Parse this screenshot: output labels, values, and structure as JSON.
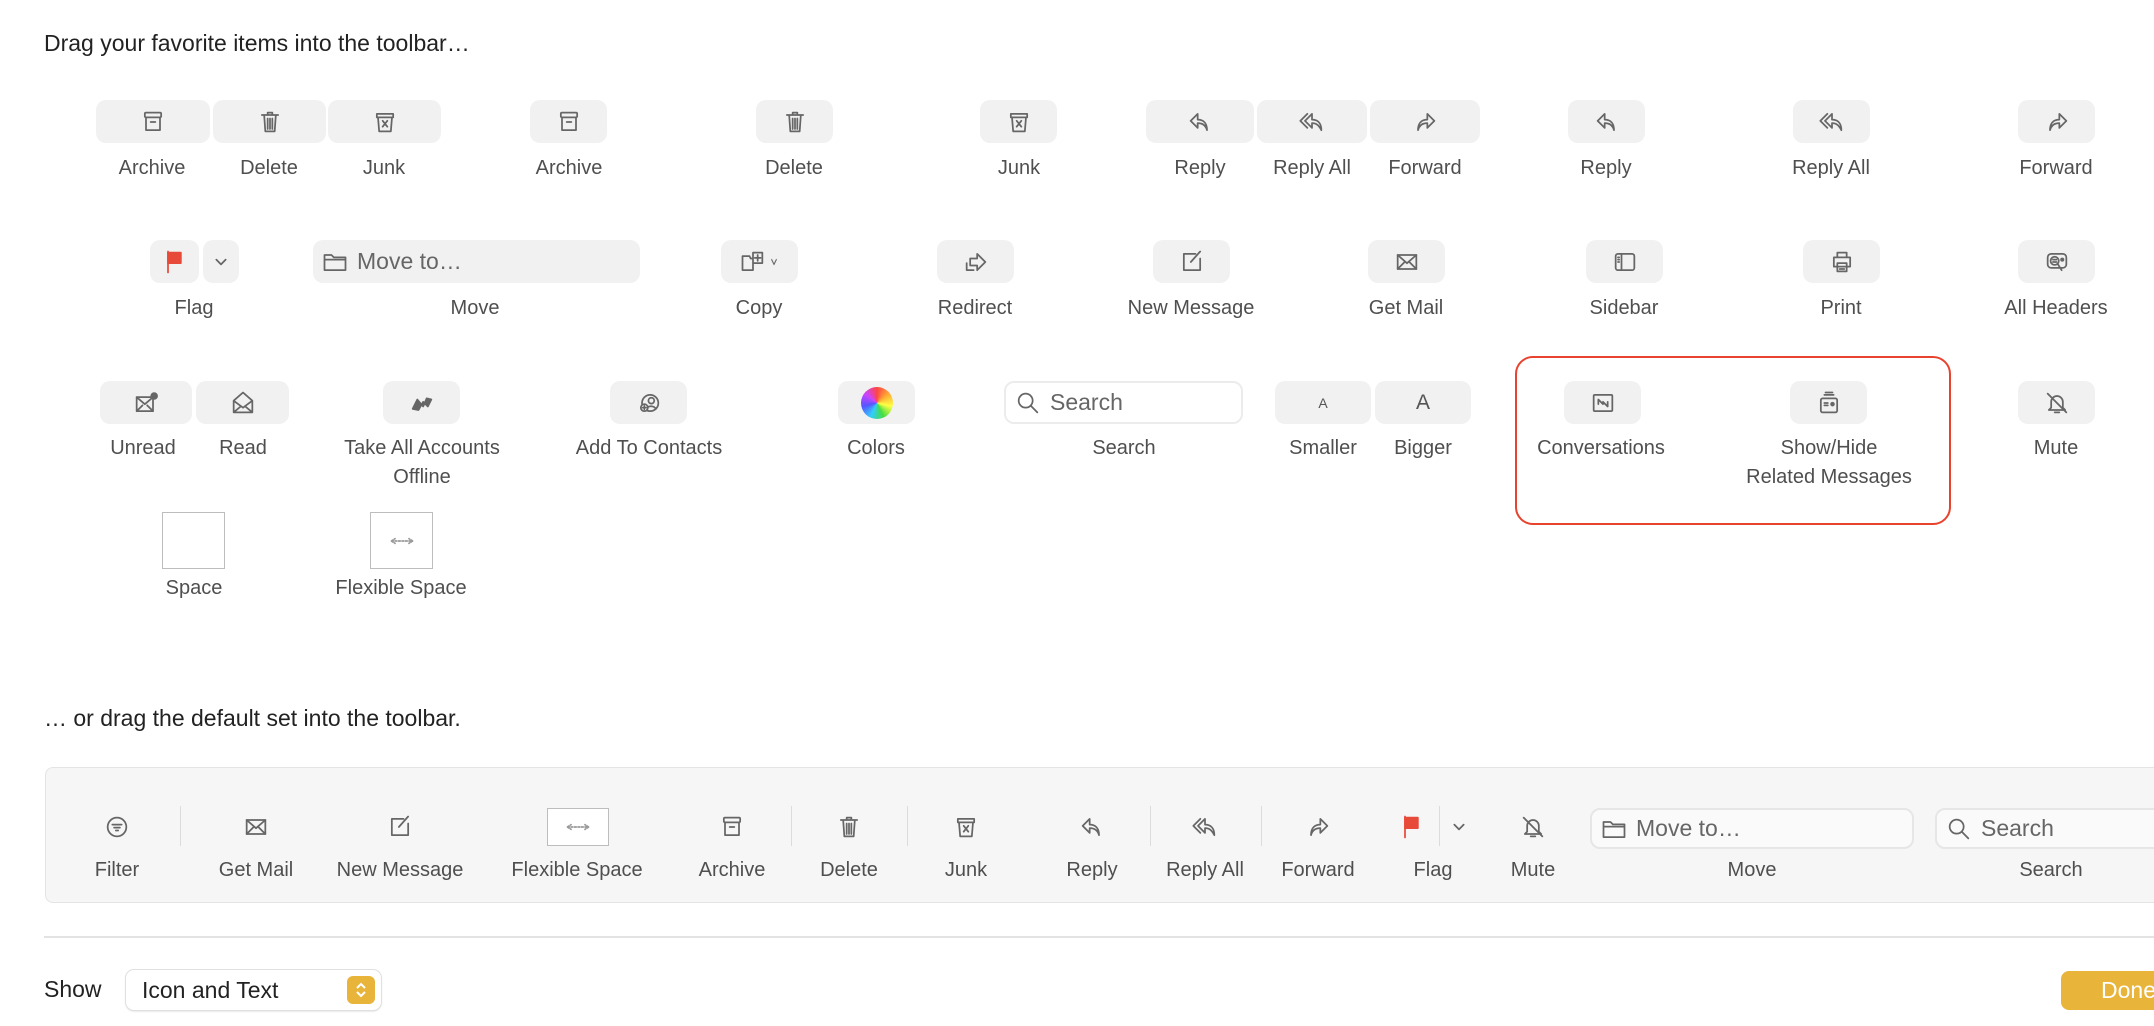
{
  "header": {
    "favorites_text": "Drag your favorite items into the toolbar…",
    "default_text": "… or drag the default set into the toolbar."
  },
  "palette": {
    "row1": [
      "Archive",
      "Delete",
      "Junk",
      "Archive",
      "Delete",
      "Junk",
      "Reply",
      "Reply All",
      "Forward",
      "Reply",
      "Reply All",
      "Forward"
    ],
    "row2": {
      "flag": "Flag",
      "move_field": "Move to…",
      "move": "Move",
      "copy": "Copy",
      "redirect": "Redirect",
      "new_message": "New Message",
      "get_mail": "Get Mail",
      "sidebar": "Sidebar",
      "print": "Print",
      "all_headers": "All Headers"
    },
    "row3": {
      "unread": "Unread",
      "read": "Read",
      "take_offline_1": "Take All Accounts",
      "take_offline_2": "Offline",
      "add_contacts": "Add To Contacts",
      "colors": "Colors",
      "search_placeholder": "Search",
      "search": "Search",
      "smaller": "Smaller",
      "bigger": "Bigger",
      "smaller_glyph": "A",
      "bigger_glyph": "A",
      "conversations": "Conversations",
      "show_hide_1": "Show/Hide",
      "show_hide_2": "Related Messages",
      "mute": "Mute"
    },
    "row4": {
      "space": "Space",
      "flexible_space": "Flexible Space"
    }
  },
  "default_set": {
    "items": [
      "Filter",
      "Get Mail",
      "New Message",
      "Flexible Space",
      "Archive",
      "Delete",
      "Junk",
      "Reply",
      "Reply All",
      "Forward",
      "Flag",
      "Mute",
      "Move",
      "Search"
    ],
    "move_field": "Move to…",
    "search_placeholder": "Search"
  },
  "footer": {
    "show_label": "Show",
    "show_value": "Icon and Text",
    "done": "Done"
  },
  "colors": {
    "accent": "#e8b43a",
    "flag": "#e84a3a",
    "highlight": "#e8432e",
    "button_bg": "#f1f1f1"
  }
}
